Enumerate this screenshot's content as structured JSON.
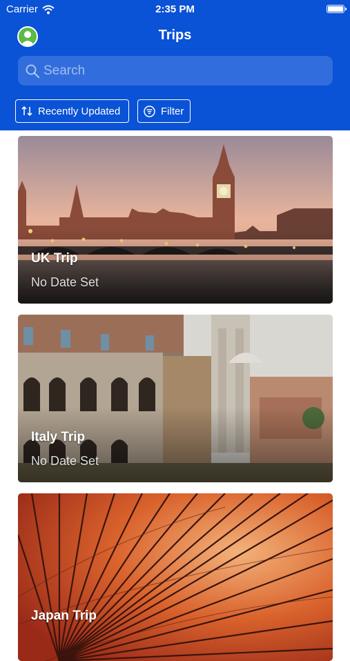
{
  "status": {
    "carrier": "Carrier",
    "time": "2:35 PM"
  },
  "header": {
    "title": "Trips"
  },
  "search": {
    "placeholder": "Search"
  },
  "sort": {
    "label": "Recently Updated"
  },
  "filter": {
    "label": "Filter"
  },
  "colors": {
    "header_bg": "#0a52d6",
    "accent_white": "#ffffff"
  },
  "trips": [
    {
      "name": "UK Trip",
      "date": "No Date Set"
    },
    {
      "name": "Italy Trip",
      "date": "No Date Set"
    },
    {
      "name": "Japan Trip",
      "date": ""
    }
  ]
}
